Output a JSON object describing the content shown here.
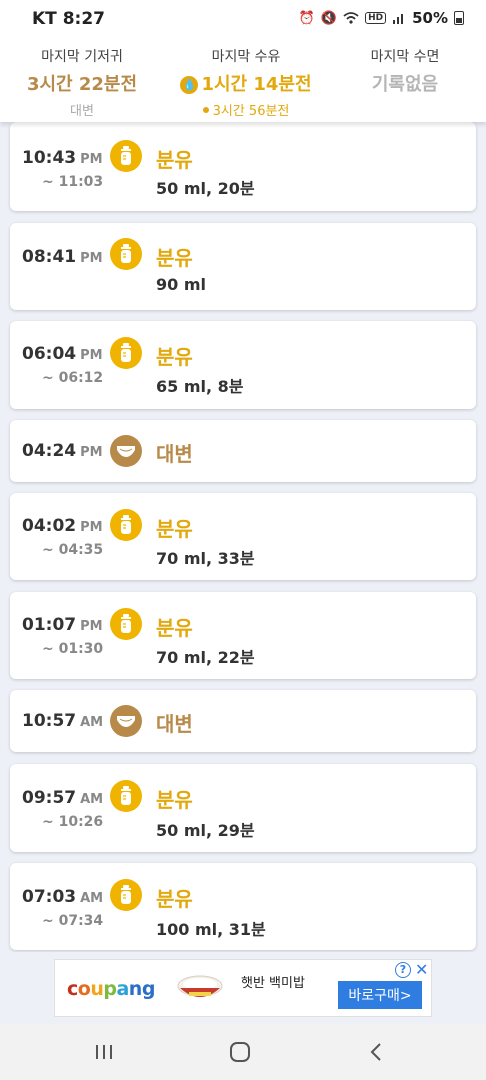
{
  "status_bar": {
    "carrier": "KT 8:27",
    "battery": "50%",
    "icons": [
      "alarm-icon",
      "mute-icon",
      "wifi-icon",
      "hd-icon",
      "signal-icon",
      "battery-icon"
    ]
  },
  "summary": {
    "diaper": {
      "label": "마지막 기저귀",
      "value": "3시간 22분전",
      "sub": "대변"
    },
    "feed": {
      "label": "마지막 수유",
      "value": "1시간 14분전",
      "sub": "3시간 56분전"
    },
    "sleep": {
      "label": "마지막 수면",
      "value": "기록없음"
    }
  },
  "records": [
    {
      "time": "10:43",
      "ampm": "PM",
      "end": "~ 11:03",
      "kind": "bottle",
      "type": "분유",
      "detail": "50 ml, 20분"
    },
    {
      "time": "08:41",
      "ampm": "PM",
      "end": "",
      "kind": "bottle",
      "type": "분유",
      "detail": "90 ml"
    },
    {
      "time": "06:04",
      "ampm": "PM",
      "end": "~ 06:12",
      "kind": "bottle",
      "type": "분유",
      "detail": "65 ml, 8분"
    },
    {
      "time": "04:24",
      "ampm": "PM",
      "end": "",
      "kind": "diaper",
      "type": "대변",
      "detail": ""
    },
    {
      "time": "04:02",
      "ampm": "PM",
      "end": "~ 04:35",
      "kind": "bottle",
      "type": "분유",
      "detail": "70 ml, 33분"
    },
    {
      "time": "01:07",
      "ampm": "PM",
      "end": "~ 01:30",
      "kind": "bottle",
      "type": "분유",
      "detail": "70 ml, 22분"
    },
    {
      "time": "10:57",
      "ampm": "AM",
      "end": "",
      "kind": "diaper",
      "type": "대변",
      "detail": ""
    },
    {
      "time": "09:57",
      "ampm": "AM",
      "end": "~ 10:26",
      "kind": "bottle",
      "type": "분유",
      "detail": "50 ml, 29분"
    },
    {
      "time": "07:03",
      "ampm": "AM",
      "end": "~ 07:34",
      "kind": "bottle",
      "type": "분유",
      "detail": "100 ml, 31분"
    }
  ],
  "ad": {
    "brand": "coupang",
    "text": "햇반 백미밥",
    "button": "바로구매>",
    "info": "?",
    "close": "✕"
  },
  "colors": {
    "feed": "#e2a80d",
    "poop": "#b88a4a",
    "bottle_icon": "#f0b400",
    "ad_button": "#2f7de1"
  }
}
